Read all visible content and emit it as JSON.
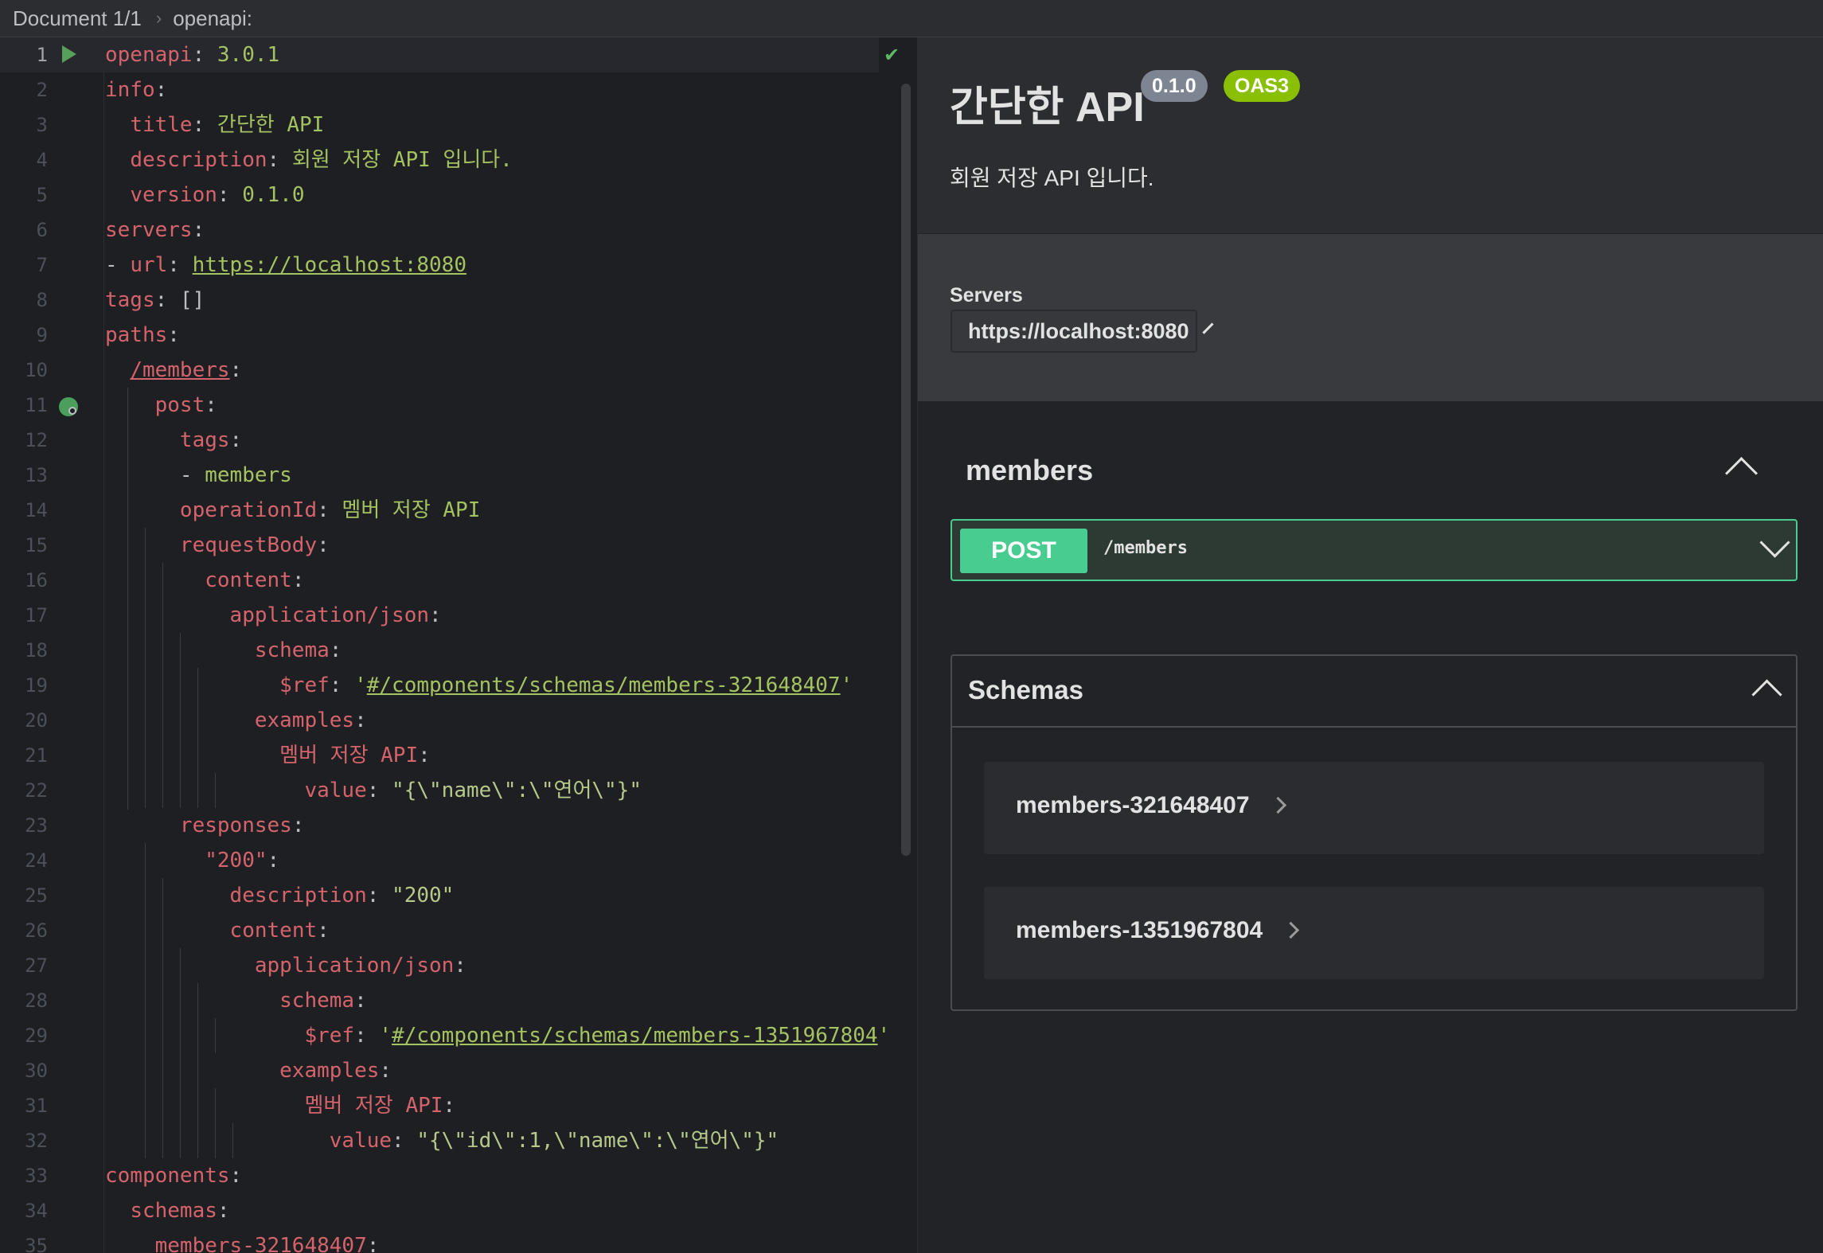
{
  "breadcrumb": {
    "doc": "Document 1/1",
    "sep": "›",
    "path": "openapi:"
  },
  "editor": {
    "lines": [
      {
        "n": "1"
      },
      {
        "n": "2"
      },
      {
        "n": "3"
      },
      {
        "n": "4"
      },
      {
        "n": "5"
      },
      {
        "n": "6"
      },
      {
        "n": "7"
      },
      {
        "n": "8"
      },
      {
        "n": "9"
      },
      {
        "n": "10"
      },
      {
        "n": "11"
      },
      {
        "n": "12"
      },
      {
        "n": "13"
      },
      {
        "n": "14"
      },
      {
        "n": "15"
      },
      {
        "n": "16"
      },
      {
        "n": "17"
      },
      {
        "n": "18"
      },
      {
        "n": "19"
      },
      {
        "n": "20"
      },
      {
        "n": "21"
      },
      {
        "n": "22"
      },
      {
        "n": "23"
      },
      {
        "n": "24"
      },
      {
        "n": "25"
      },
      {
        "n": "26"
      },
      {
        "n": "27"
      },
      {
        "n": "28"
      },
      {
        "n": "29"
      },
      {
        "n": "30"
      },
      {
        "n": "31"
      },
      {
        "n": "32"
      },
      {
        "n": "33"
      },
      {
        "n": "34"
      },
      {
        "n": "35"
      }
    ],
    "code": {
      "l1k": "openapi",
      "l1v": "3.0.1",
      "l2k": "info",
      "l3k": "title",
      "l3v": "간단한 API",
      "l4k": "description",
      "l4v": "회원 저장 API 입니다.",
      "l5k": "version",
      "l5v": "0.1.0",
      "l6k": "servers",
      "l7k": "url",
      "l7v": "https://localhost:8080",
      "l8k": "tags",
      "l8v": "[]",
      "l9k": "paths",
      "l10k": "/members",
      "l11k": "post",
      "l12k": "tags",
      "l13v": "members",
      "l14k": "operationId",
      "l14v": "멤버 저장 API",
      "l15k": "requestBody",
      "l16k": "content",
      "l17k": "application/json",
      "l18k": "schema",
      "l19k": "$ref",
      "l19v": "#/components/schemas/members-321648407",
      "l20k": "examples",
      "l21k": "멤버 저장 API",
      "l22k": "value",
      "l22v": "\"{\\\"name\\\":\\\"연어\\\"}\"",
      "l23k": "responses",
      "l24k": "\"200\"",
      "l25k": "description",
      "l25v": "\"200\"",
      "l26k": "content",
      "l27k": "application/json",
      "l28k": "schema",
      "l29k": "$ref",
      "l29v": "#/components/schemas/members-1351967804",
      "l30k": "examples",
      "l31k": "멤버 저장 API",
      "l32k": "value",
      "l32v": "\"{\\\"id\\\":1,\\\"name\\\":\\\"연어\\\"}\"",
      "l33k": "components",
      "l34k": "schemas",
      "l35k": "members-321648407"
    }
  },
  "preview": {
    "title": "간단한 API",
    "version_badge": "0.1.0",
    "oas_badge": "OAS3",
    "description": "회원 저장 API 입니다.",
    "servers_label": "Servers",
    "server_selected": "https://localhost:8080",
    "tag_name": "members",
    "operation": {
      "method": "POST",
      "path": "/members"
    },
    "schemas_title": "Schemas",
    "models": [
      "members-321648407",
      "members-1351967804"
    ]
  },
  "colors": {
    "post": "#49cc90",
    "oas": "#89bf04",
    "version": "#7d8492"
  }
}
